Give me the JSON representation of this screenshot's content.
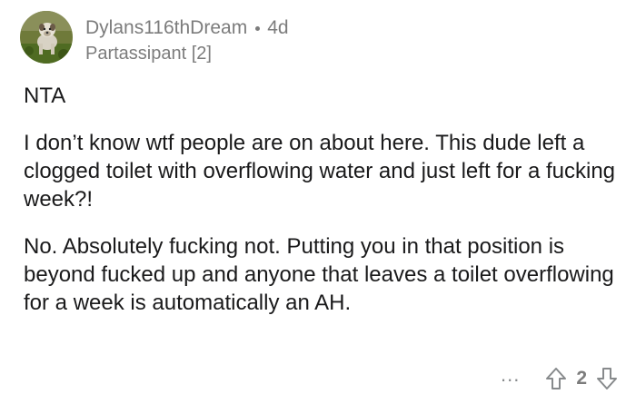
{
  "comment": {
    "username": "Dylans116thDream",
    "age": "4d",
    "flair": "Partassipant [2]",
    "paragraphs": [
      "NTA",
      "I don’t know wtf people are on about here. This dude left a clogged toilet with overflowing water and just left for a fucking week?!",
      "No. Absolutely fucking not. Putting you in that position is beyond fucked up and anyone that leaves a toilet overflowing for a week is automatically an AH."
    ],
    "more_label": "...",
    "score": "2"
  },
  "icons": {
    "avatar": "dog-avatar-icon",
    "upvote": "upvote-arrow-icon",
    "downvote": "downvote-arrow-icon",
    "more": "more-options-icon"
  },
  "colors": {
    "text": "#1a1a1b",
    "meta": "#7c7c7c",
    "background": "#ffffff"
  }
}
